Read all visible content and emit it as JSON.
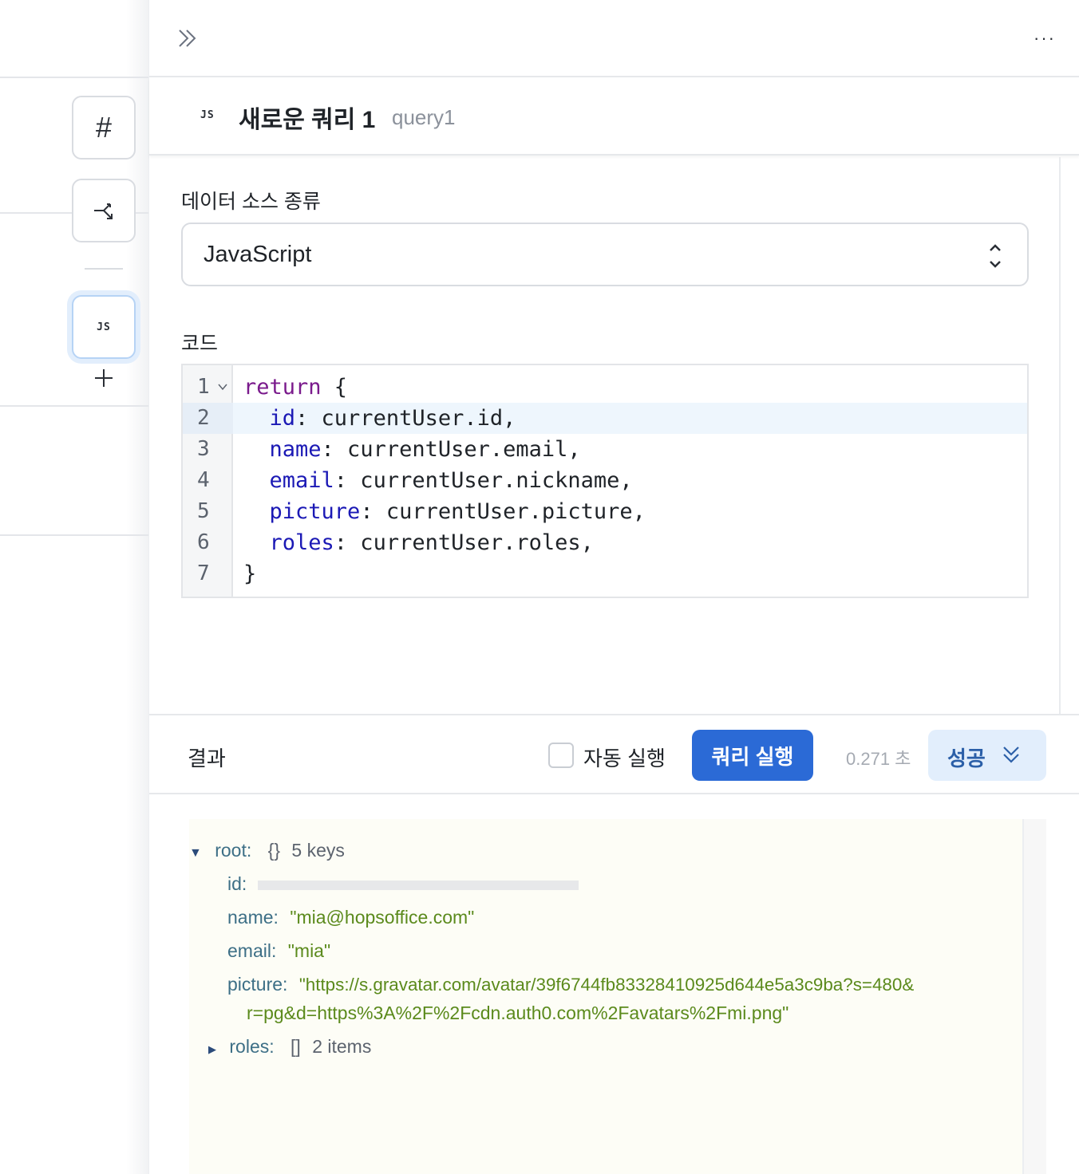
{
  "left_rail": {
    "hash_label": "#",
    "js_label": "JS"
  },
  "header": {
    "more_label": "···"
  },
  "query": {
    "badge": "JS",
    "title": "새로운 쿼리 1",
    "id": "query1"
  },
  "config": {
    "datasource_label": "데이터 소스 종류",
    "datasource_value": "JavaScript",
    "code_label": "코드",
    "code_lines": [
      {
        "no": "1",
        "text": "return {"
      },
      {
        "no": "2",
        "text": "  id: currentUser.id,"
      },
      {
        "no": "3",
        "text": "  name: currentUser.email,"
      },
      {
        "no": "4",
        "text": "  email: currentUser.nickname,"
      },
      {
        "no": "5",
        "text": "  picture: currentUser.picture,"
      },
      {
        "no": "6",
        "text": "  roles: currentUser.roles,"
      },
      {
        "no": "7",
        "text": "}"
      }
    ],
    "active_line": 2
  },
  "results": {
    "label": "결과",
    "auto_run_label": "자동 실행",
    "auto_run_checked": false,
    "run_button": "쿼리 실행",
    "elapsed": "0.271 초",
    "status": "성공",
    "tree": {
      "root_key": "root:",
      "root_type": "{}",
      "root_count": "5 keys",
      "id_key": "id:",
      "name_key": "name:",
      "name_value": "\"mia@hopsoffice.com\"",
      "email_key": "email:",
      "email_value": "\"mia\"",
      "picture_key": "picture:",
      "picture_value_1": "\"https://s.gravatar.com/avatar/39f6744fb83328410925d644e5a3c9ba?s=480&",
      "picture_value_2": "r=pg&d=https%3A%2F%2Fcdn.auth0.com%2Favatars%2Fmi.png\"",
      "roles_key": "roles:",
      "roles_type": "[]",
      "roles_count": "2 items"
    }
  },
  "colors": {
    "accent": "#2b6ad6",
    "status_bg": "#e2eefc",
    "string_value": "#5b8a1c"
  }
}
